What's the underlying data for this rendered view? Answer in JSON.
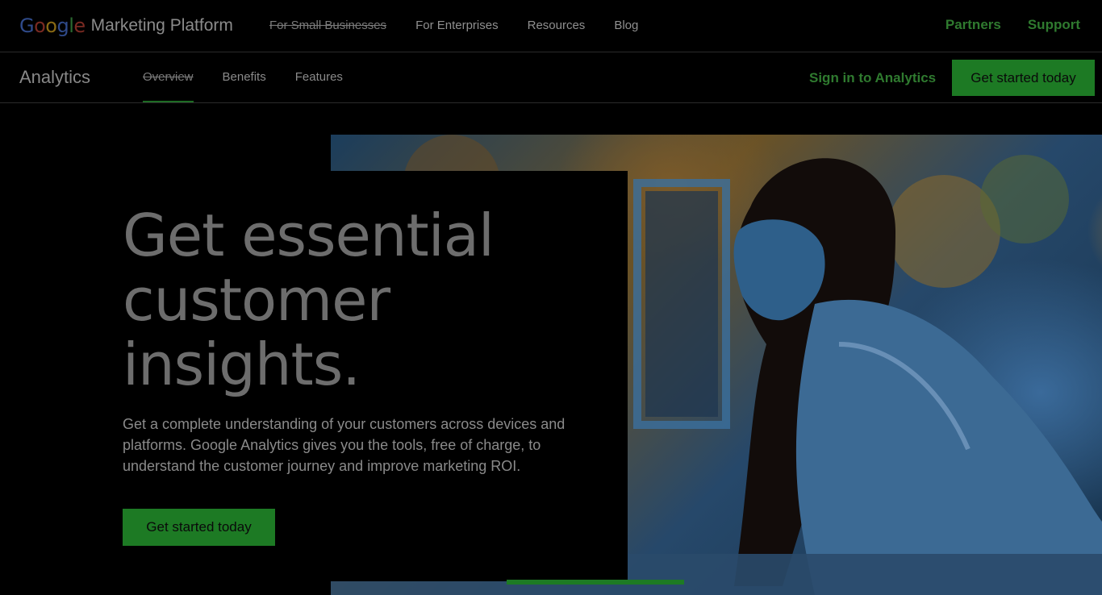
{
  "header": {
    "brand_google_letters": [
      "G",
      "o",
      "o",
      "g",
      "l",
      "e"
    ],
    "brand_product": "Marketing Platform",
    "nav": [
      {
        "label": "For Small Businesses"
      },
      {
        "label": "For Enterprises"
      },
      {
        "label": "Resources"
      },
      {
        "label": "Blog"
      }
    ],
    "right_links": [
      {
        "label": "Partners"
      },
      {
        "label": "Support"
      }
    ]
  },
  "subheader": {
    "product_title": "Analytics",
    "tabs": [
      {
        "label": "Overview",
        "active": true
      },
      {
        "label": "Benefits",
        "active": false
      },
      {
        "label": "Features",
        "active": false
      }
    ],
    "signin_label": "Sign in to Analytics",
    "cta_label": "Get started today"
  },
  "hero": {
    "title_lines": [
      "Get essential",
      "customer",
      "insights."
    ],
    "description": "Get a complete understanding of your customers across devices and platforms. Google Analytics gives you the tools, free of charge, to understand the customer journey and improve marketing ROI.",
    "cta_label": "Get started today",
    "image_icon": "woman-at-laptop-photo"
  },
  "colors": {
    "accent_green": "#1d7a24",
    "link_green": "#2f7a2f",
    "background": "#000000"
  }
}
